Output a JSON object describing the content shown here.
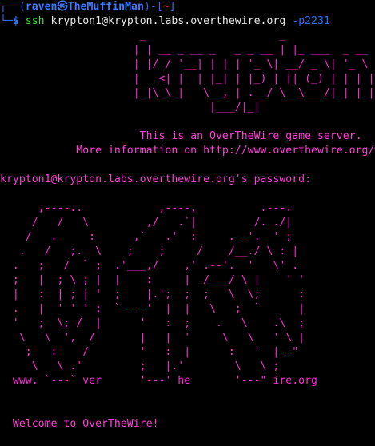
{
  "prompt": {
    "box_top": "┌──(",
    "user": "raven",
    "at_glyph": "㉿",
    "host": "TheMuffinMan",
    "mid": ")-[",
    "cwd": "~",
    "close": "]",
    "box_bottom": "└─",
    "dollar": "$ ",
    "command_name": "ssh",
    "command_target": " krypton1@krypton.labs.overthewire.org ",
    "command_option": "-p2231"
  },
  "krypton_banner": [
    "                      _                     _",
    "                     | | __ _ __ _   _ _ __ | |_ ___  _ __",
    "                     | |/ / '__| | | | '_ \\| __/ _ \\| '_ \\",
    "                     |   <| |  | |_| | |_) | || (_) | | | |",
    "                     |_|\\_\\_|   \\__, | .__/ \\__\\___/|_| |_|",
    "                                 |___/|_|"
  ],
  "server_info": {
    "line1": "                      This is an OverTheWire game server.",
    "line2": "            More information on http://www.overthewire.org/wargames"
  },
  "password_prompt": "krypton1@krypton.labs.overthewire.org's password: ",
  "otw_art": [
    "      ,----..            ,----,          .---.",
    "     /   /   \\         ,/   .`|         /. ./|",
    "    /   .     :      ,`   .'  :     .--'.  ' ;",
    "   .   /   ;.  \\    ;    ;     /    /__./ \\ : |",
    "  .   ;   /  ` ;  .'___,/    ,' .--'.  '   \\' .",
    "  ;   |  ; \\ ; |  |    :     |  /___/ \\ |    ' '",
    "  |   :  | ; | '  ;    |.';  ;  ;   \\  \\;      :",
    "  .   |  ' ' ' :  `----'  |  |   \\   ;  `      |",
    "  '   ;  \\; /  |      '   :  ;    .   \\    .\\  ;",
    "   \\   \\  ',  /       |   |  '     \\   \\   ' \\ |",
    "    ;   :    /        '   :  |      :   '  |--\"",
    "     \\   \\ .'         ;   |.'        \\   \\ ;",
    "  www. `---` ver      '---' he       '---\" ire.org"
  ],
  "welcome": "  Welcome to OverTheWire!"
}
